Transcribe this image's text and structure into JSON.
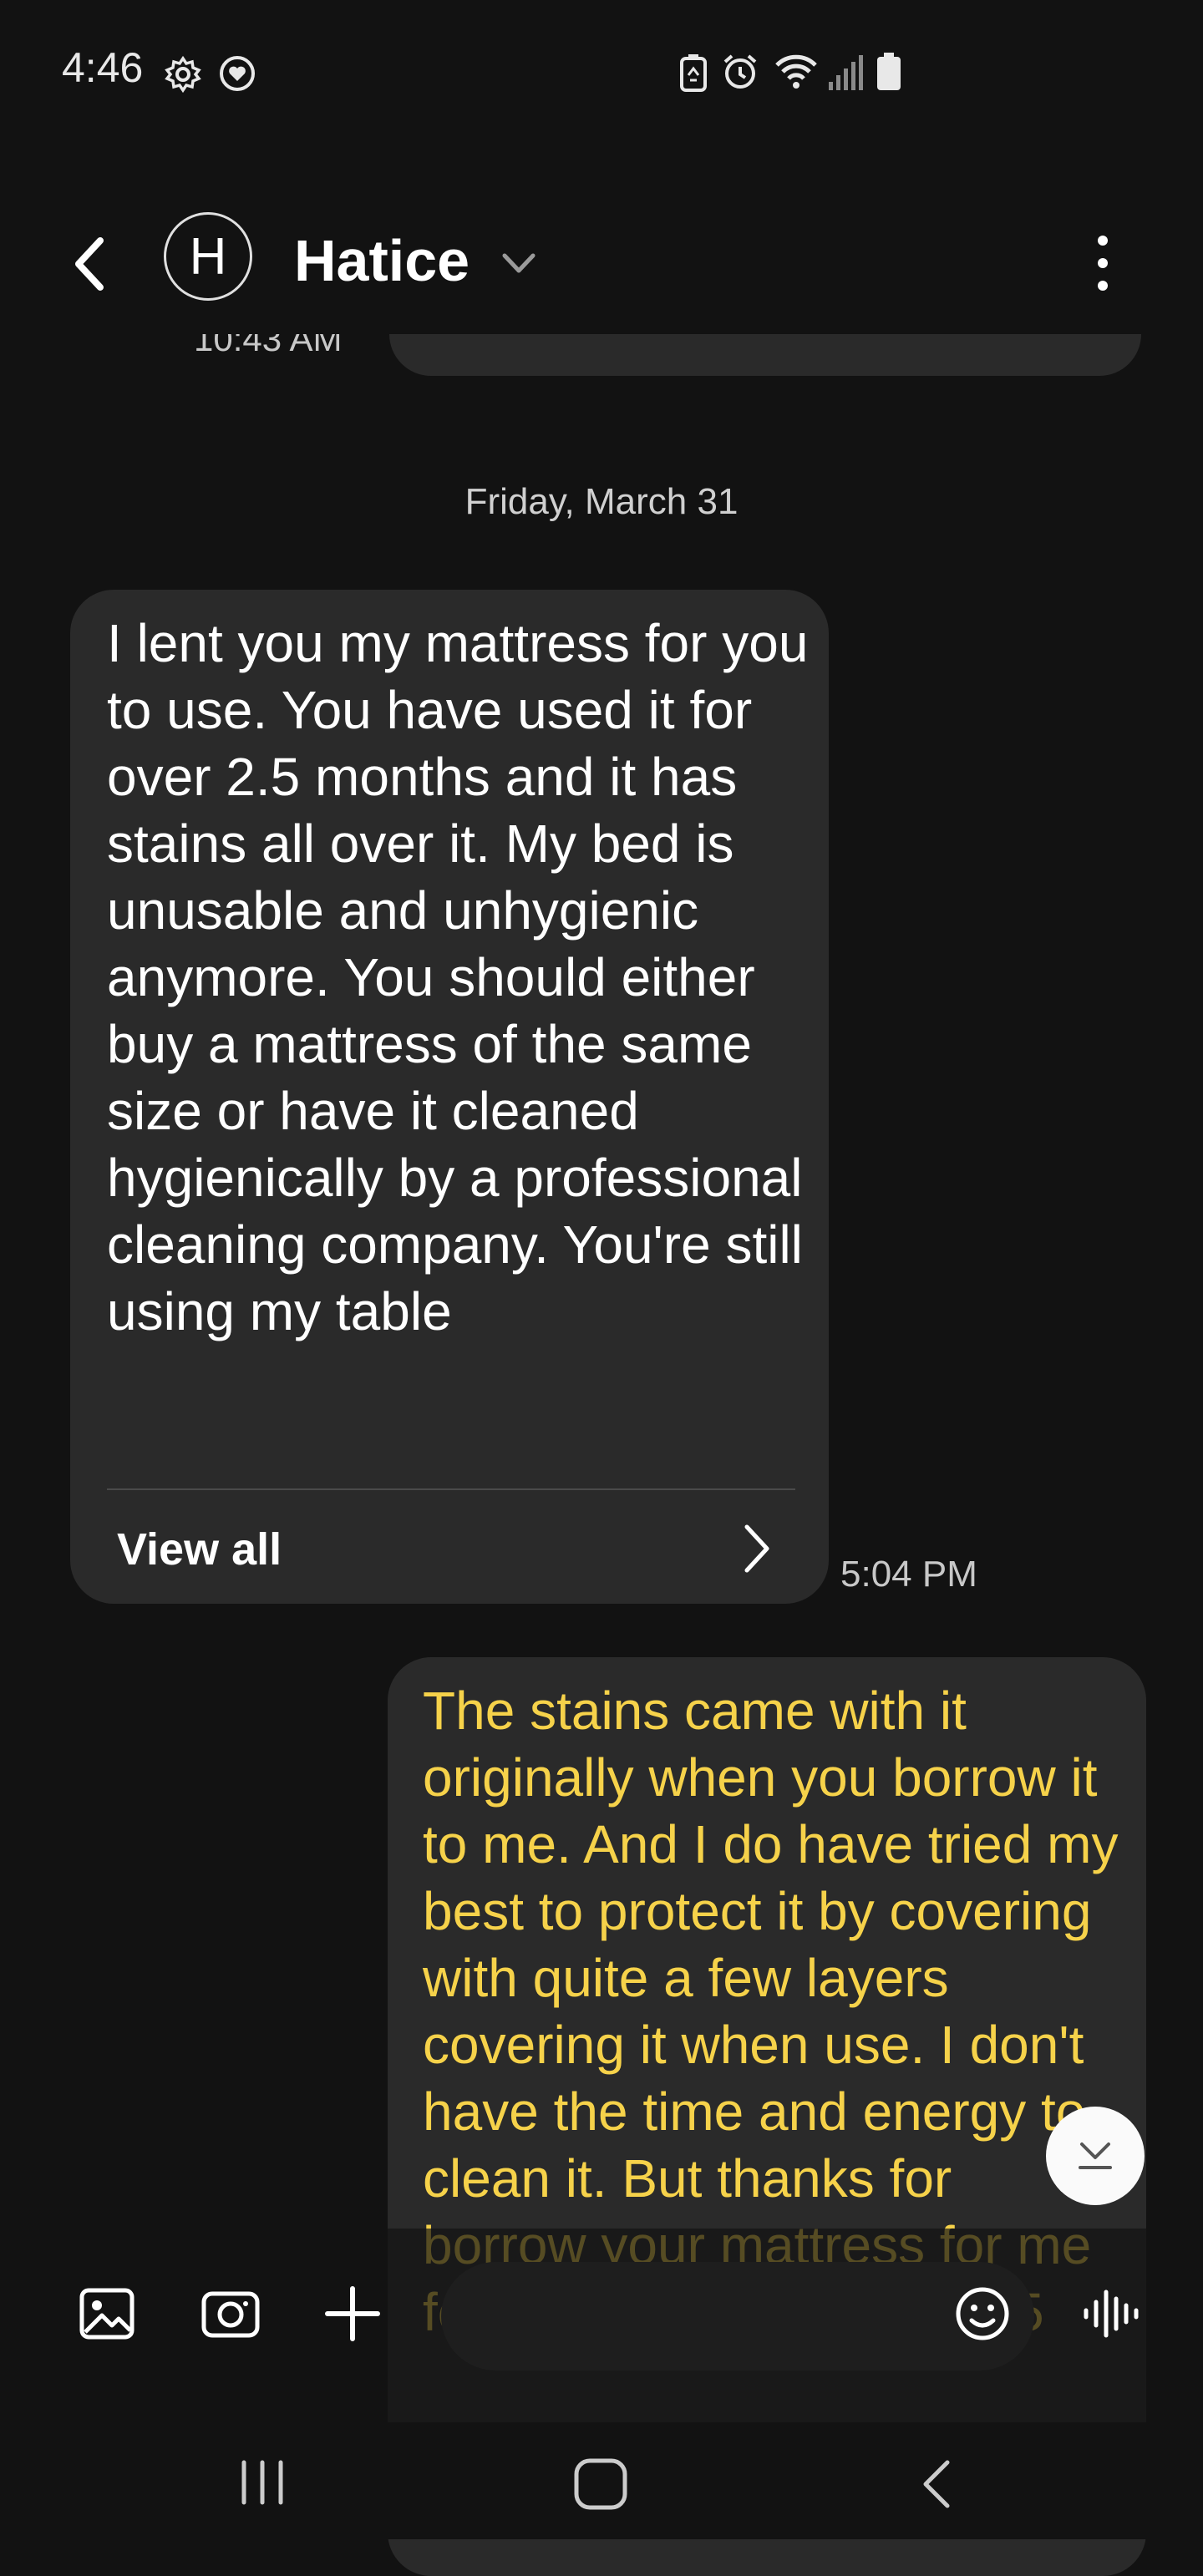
{
  "status_bar": {
    "time": "4:46",
    "left_icons": [
      "gear-icon",
      "heart-shield-icon"
    ],
    "right_icons": [
      "battery-saver-icon",
      "alarm-icon",
      "wifi-icon",
      "signal-icon",
      "battery-icon"
    ]
  },
  "header": {
    "avatar_letter": "H",
    "contact_name": "Hatice"
  },
  "conversation": {
    "previous_time_partial": "10:43 AM",
    "date_separator": "Friday, March 31",
    "messages": [
      {
        "direction": "incoming",
        "text": "I lent you my mattress for you to use.  You have used it for over 2.5 months and it has stains all over it.  My bed is unusable and unhygienic anymore.  You should either buy a mattress of the same size or have it cleaned hygienically by a professional cleaning company.  You're still using my table",
        "view_all_label": "View all",
        "time": "5:04 PM"
      },
      {
        "direction": "outgoing",
        "text": "The stains came with it originally when you borrow it to me. And I do have tried my best to protect it by covering with quite a few layers covering it when use. I don't have the time and energy to clean it. But thanks for borrow your mattress for me for use during the past 2.5"
      }
    ]
  },
  "colors": {
    "background": "#121212",
    "bubble": "#2a2a2a",
    "outgoing_text": "#f6d24a",
    "incoming_text": "#ffffff"
  },
  "input_bar": {
    "icons": [
      "gallery-icon",
      "camera-icon",
      "plus-icon",
      "emoji-icon",
      "voice-icon"
    ]
  },
  "nav_bar": {
    "icons": [
      "recent-apps-icon",
      "home-icon",
      "back-icon"
    ]
  }
}
